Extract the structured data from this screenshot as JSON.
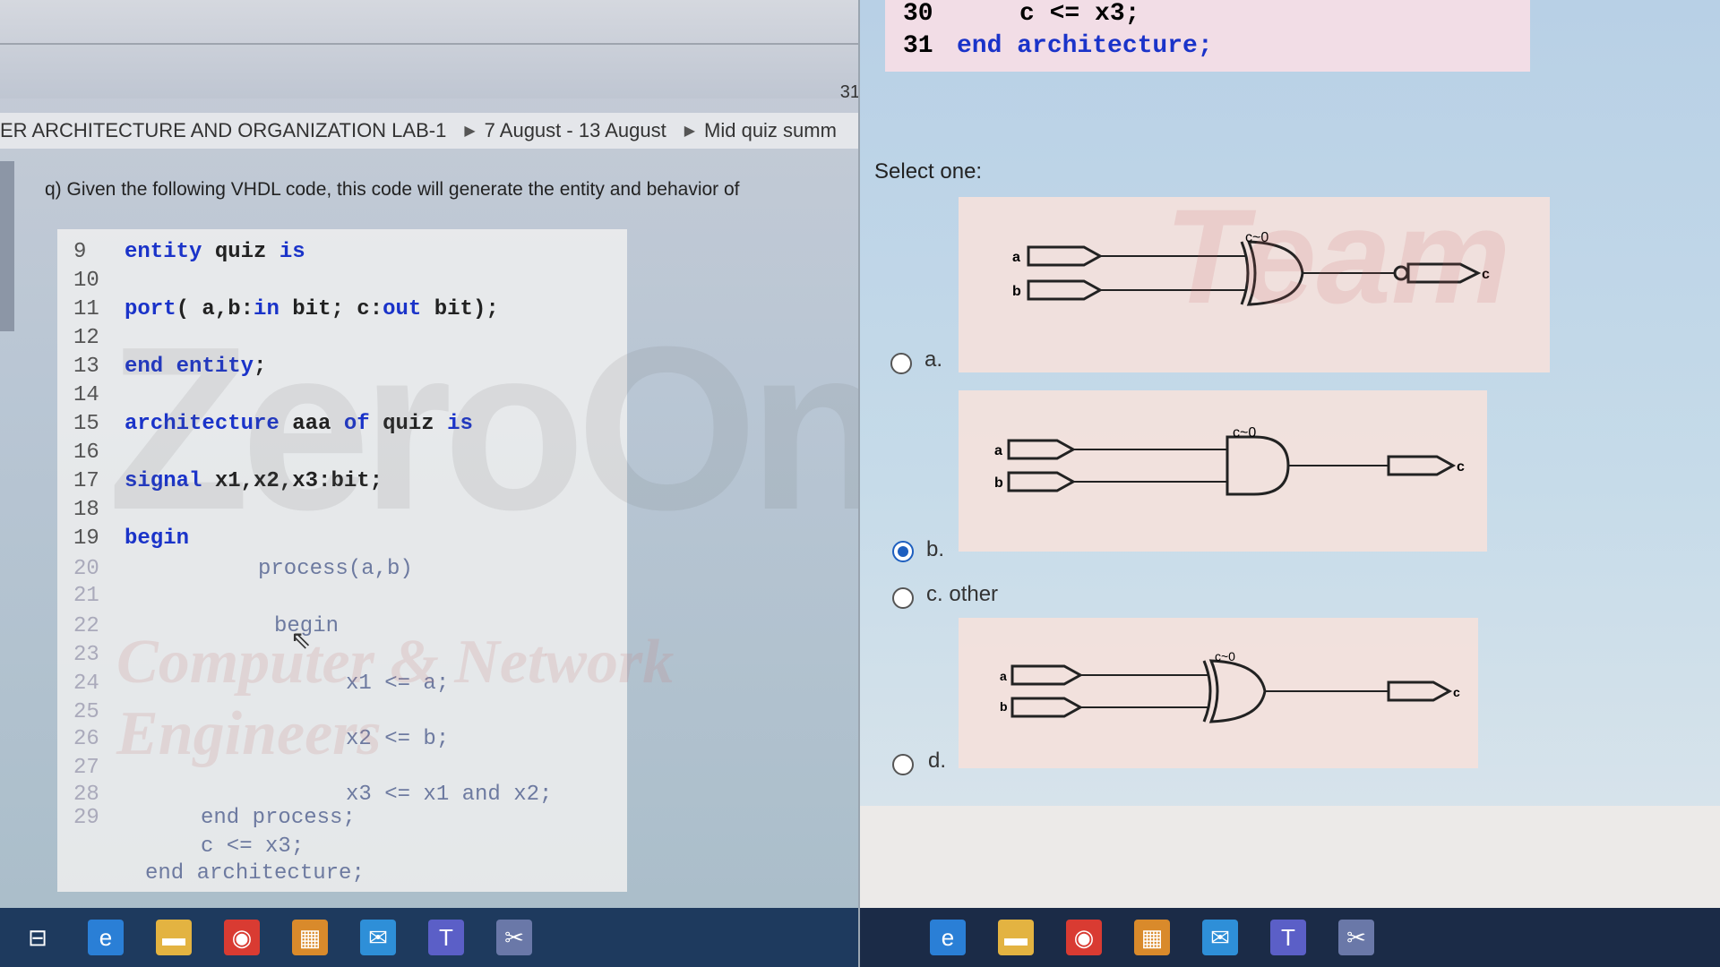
{
  "left": {
    "page_number": "31",
    "breadcrumb": [
      "ER ARCHITECTURE AND ORGANIZATION LAB-1",
      "7 August - 13 August",
      "Mid quiz summ"
    ],
    "question": "q) Given the following VHDL code, this code will generate the entity and behavior of",
    "code_lines": [
      {
        "n": "9",
        "code": "entity quiz is"
      },
      {
        "n": "10",
        "code": ""
      },
      {
        "n": "11",
        "code": "port( a,b:in bit; c:out bit);"
      },
      {
        "n": "12",
        "code": ""
      },
      {
        "n": "13",
        "code": "end entity;"
      },
      {
        "n": "14",
        "code": ""
      },
      {
        "n": "15",
        "code": "architecture aaa of quiz is"
      },
      {
        "n": "16",
        "code": ""
      },
      {
        "n": "17",
        "code": "signal x1,x2,x3:bit;"
      },
      {
        "n": "18",
        "code": ""
      },
      {
        "n": "19",
        "code": "begin"
      },
      {
        "n": "20",
        "code": "process(a,b)"
      },
      {
        "n": "21",
        "code": ""
      },
      {
        "n": "22",
        "code": "begin"
      },
      {
        "n": "23",
        "code": ""
      },
      {
        "n": "24",
        "code": "x1 <= a;"
      },
      {
        "n": "25",
        "code": ""
      },
      {
        "n": "26",
        "code": "x2 <= b;"
      },
      {
        "n": "27",
        "code": ""
      },
      {
        "n": "28",
        "code": "x3 <= x1 and x2;"
      },
      {
        "n": "29",
        "code": "end process;"
      },
      {
        "n": "",
        "code": "c <= x3;"
      },
      {
        "n": "",
        "code": "end architecture;"
      }
    ],
    "watermark_main": "ZeroOne",
    "watermark_sub": "Computer & Network Engineers"
  },
  "right": {
    "code_lines": [
      {
        "n": "30",
        "code": "c <= x3;"
      },
      {
        "n": "31",
        "code": "end architecture;"
      }
    ],
    "select_one": "Select one:",
    "options": [
      {
        "letter": "a.",
        "text": "",
        "checked": false,
        "gate": "xor-inverted-output"
      },
      {
        "letter": "b.",
        "text": "",
        "checked": true,
        "gate": "and"
      },
      {
        "letter": "c.",
        "text": "other",
        "checked": false,
        "gate": ""
      },
      {
        "letter": "d.",
        "text": "",
        "checked": false,
        "gate": "xor"
      }
    ],
    "gate_labels": {
      "a": "a",
      "b": "b",
      "c": "c",
      "cond": "c~0"
    },
    "watermark": "Team"
  },
  "taskbar_icons": [
    "task-view-icon",
    "edge-icon",
    "file-explorer-icon",
    "chrome-icon",
    "store-icon",
    "mail-icon",
    "teams-icon",
    "snipping-tool-icon"
  ]
}
